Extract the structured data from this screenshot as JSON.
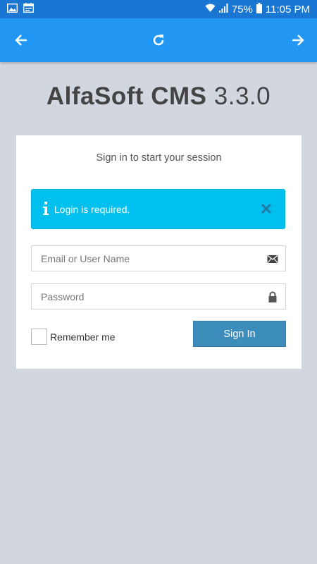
{
  "status_bar": {
    "battery_percent": "75%",
    "time": "11:05 PM",
    "icons": [
      "image-icon",
      "calendar-icon",
      "wifi-icon",
      "signal-icon",
      "battery-icon"
    ]
  },
  "toolbar": {
    "icons": [
      "arrow-left-icon",
      "refresh-icon",
      "arrow-right-icon"
    ]
  },
  "logo": {
    "name_bold": "AlfaSoft CMS",
    "version": "3.3.0"
  },
  "login": {
    "title": "Sign in to start your session",
    "alert": {
      "text": "Login is required.",
      "icon": "info-icon",
      "close_icon": "close-icon"
    },
    "email": {
      "placeholder": "Email or User Name",
      "value": "",
      "icon": "envelope-icon"
    },
    "password": {
      "placeholder": "Password",
      "value": "",
      "icon": "lock-icon"
    },
    "remember_label": "Remember me",
    "remember_checked": false,
    "signin_label": "Sign In"
  },
  "colors": {
    "status_bar": "#1976d2",
    "toolbar": "#2196f3",
    "background": "#d2d6de",
    "alert": "#00c0ef",
    "button": "#3c8dbc"
  }
}
